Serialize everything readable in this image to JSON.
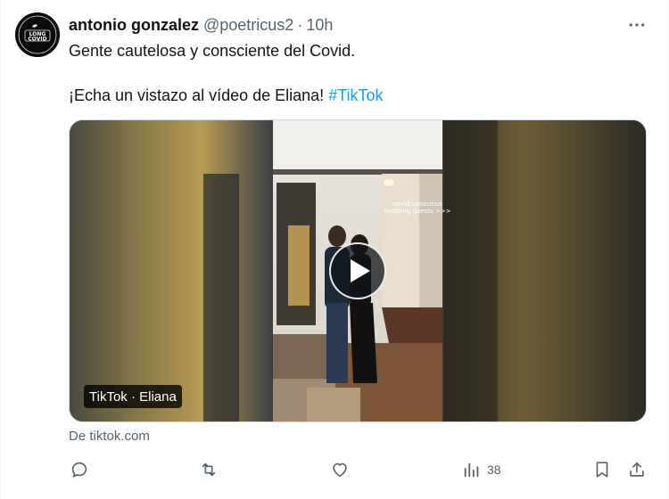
{
  "author": {
    "name": "antonio gonzalez",
    "handle": "@poetricus2",
    "separator": "·",
    "time": "10h",
    "avatar_text_top": "LONG",
    "avatar_text_bottom": "COVID"
  },
  "tweet": {
    "line1": "Gente cautelosa y consciente del Covid.",
    "line2_prefix": "¡Echa un vistazo al vídeo de Eliana! ",
    "hashtag": "#TikTok"
  },
  "media": {
    "overlay_line1": "covid conscious",
    "overlay_line2": "wedding guests >>>",
    "badge": "TikTok · Eliana"
  },
  "source": "De tiktok.com",
  "actions": {
    "views_count": "38"
  },
  "colors": {
    "link": "#1d9bf0",
    "secondary": "#536471",
    "text": "#0f1419"
  },
  "icons": [
    "more-icon",
    "play-icon",
    "reply-icon",
    "retweet-icon",
    "like-icon",
    "views-icon",
    "bookmark-icon",
    "share-icon"
  ]
}
